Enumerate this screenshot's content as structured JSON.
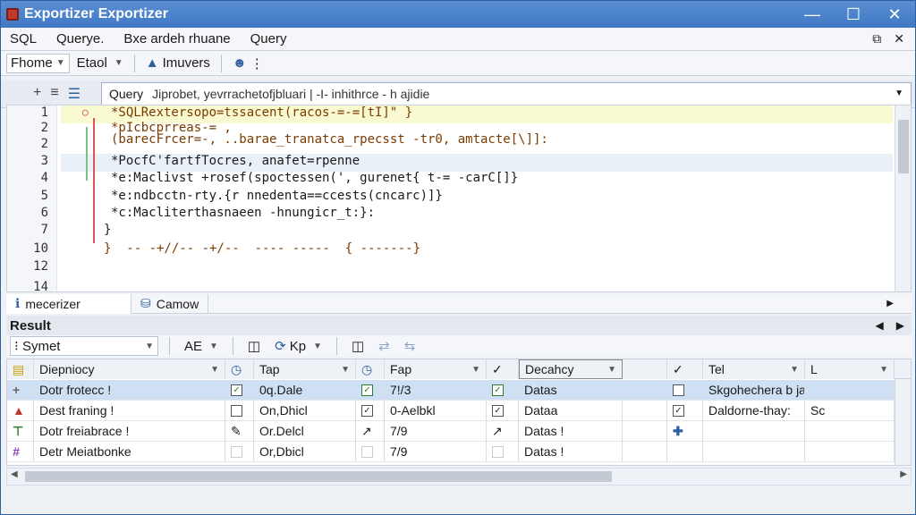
{
  "window": {
    "title": "Exportizer Exportizer"
  },
  "menubar": {
    "items": [
      "SQL",
      "Querye.",
      "Bxe ardeh rhuane",
      "Query"
    ]
  },
  "toolbar": {
    "home": "Fhome",
    "tool": "Etaol",
    "imuvers": "Imuvers"
  },
  "querybar": {
    "label": "Query",
    "text": "Jiprobet, yevrrachetofjbluari | -I- inhithrce - h ajidie"
  },
  "editor": {
    "line_numbers": [
      "1",
      "2",
      "2",
      "3",
      "4",
      "5",
      "6",
      "7",
      "10",
      "12",
      "14"
    ],
    "lines": [
      "*SQLRextersopo=tssacent(racos-=-=[tI]\" }",
      "*pIcbcprreas-= ,",
      "(barecFrcer=-, ..barae_tranatca_rpecsst -tr0, amtacte[\\]]:",
      "*PocfC'fartfTocres, anafet=rpenne",
      "*e:Maclivst +rosef(spoctessen(', gurenet{ t-= -carC[]}",
      "*e:ndbcctn-rty.{r nnedenta==ccests(cncarc)]}",
      "*c:Macliterthasnaeen -hnungicr_t:}:",
      "}",
      "}  -- -+//-- -+/--  ---- -----  { -------}"
    ]
  },
  "tabs": {
    "first": "mecerizer",
    "second": "Camow"
  },
  "result": {
    "title": "Result",
    "toolbar_combo": "Symet",
    "tb_label_a": "AE",
    "tb_label_b": "Kp"
  },
  "grid": {
    "headers": [
      "Diepniocy",
      "Tap",
      "Fap",
      "Decahcy",
      "Tel",
      "L"
    ],
    "rows": [
      {
        "name": "Dotr frotecc !",
        "col2": "0q.Dale",
        "col3": "7!/3",
        "col4": "Datas",
        "col5": "Skgohechera b jak",
        "col6": ""
      },
      {
        "name": "Dest franing !",
        "col2": "On,Dhicl",
        "col3": "0-Aelbkl",
        "col4": "Dataa",
        "col5": "Daldorne-thay:",
        "col6": "Sc"
      },
      {
        "name": "Dotr freiabrace !",
        "col2": "Or.Delcl",
        "col3": "7/9",
        "col4": "Datas !",
        "col5": "",
        "col6": ""
      },
      {
        "name": "Detr Meiatbonke",
        "col2": "Or,Dbicl",
        "col3": "7/9",
        "col4": "Datas !",
        "col5": "",
        "col6": ""
      }
    ]
  },
  "colors": {
    "titlebar": "#3f78c4",
    "selection": "#cfe0f5",
    "accent_green": "#2a7d2a"
  }
}
